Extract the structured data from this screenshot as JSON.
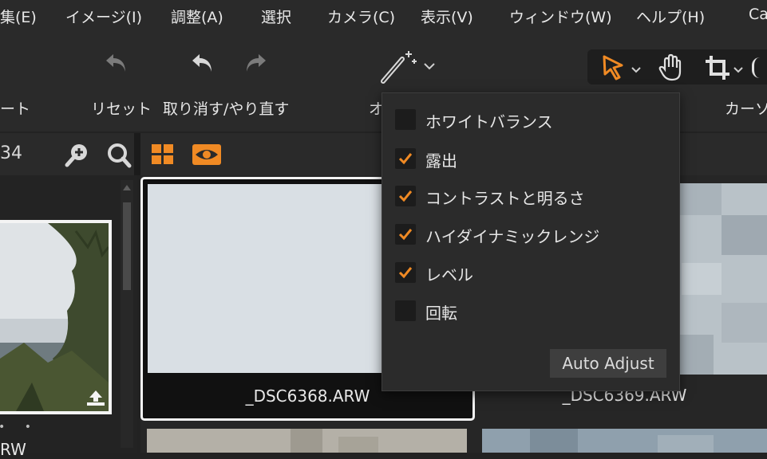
{
  "menubar": {
    "items": [
      "集(E)",
      "イメージ(I)",
      "調整(A)",
      "選択",
      "カメラ(C)",
      "表示(V)",
      "ウィンドウ(W)",
      "ヘルプ(H)",
      "Ca"
    ]
  },
  "toolbar": {
    "left_label": "ート",
    "reset_label": "リセット",
    "undo_redo_label": "取り消す/やり直す",
    "auto_label_partial": "オ",
    "cursor_label": "カーソ"
  },
  "subbar": {
    "left_text": "34"
  },
  "browser": {
    "left_caption": "RW",
    "left_dots": "• •",
    "thumbnails": [
      {
        "filename": "_DSC6368.ARW",
        "selected": true
      },
      {
        "filename": "_DSC6369.ARW",
        "selected": false
      }
    ]
  },
  "auto_adjust_popup": {
    "options": [
      {
        "label": "ホワイトバランス",
        "checked": false
      },
      {
        "label": "露出",
        "checked": true
      },
      {
        "label": "コントラストと明るさ",
        "checked": true
      },
      {
        "label": "ハイダイナミックレンジ",
        "checked": true
      },
      {
        "label": "レベル",
        "checked": true
      },
      {
        "label": "回転",
        "checked": false
      }
    ],
    "button_label": "Auto Adjust"
  },
  "colors": {
    "accent": "#f08a24",
    "background": "#222222",
    "panel": "#2a2a2a"
  }
}
